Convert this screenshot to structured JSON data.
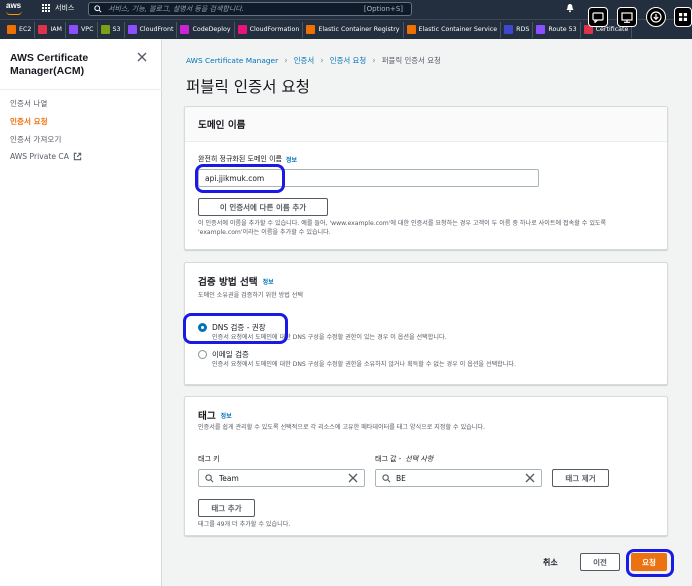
{
  "topnav": {
    "logo": "aws",
    "services_label": "서비스",
    "search_placeholder": "서비스, 기능, 블로그, 설명서 등을 검색합니다.",
    "search_shortcut": "[Option+S]"
  },
  "bookmarks": [
    {
      "label": "EC2",
      "color": "#ed7100"
    },
    {
      "label": "IAM",
      "color": "#dd344c"
    },
    {
      "label": "VPC",
      "color": "#8c4fff"
    },
    {
      "label": "S3",
      "color": "#7aa116"
    },
    {
      "label": "CloudFront",
      "color": "#8c4fff"
    },
    {
      "label": "CodeDeploy",
      "color": "#c925d1"
    },
    {
      "label": "CloudFormation",
      "color": "#e7157b"
    },
    {
      "label": "Elastic Container Registry",
      "color": "#ed7100"
    },
    {
      "label": "Elastic Container Service",
      "color": "#ed7100"
    },
    {
      "label": "RDS",
      "color": "#3f48cc"
    },
    {
      "label": "Route 53",
      "color": "#8c4fff"
    },
    {
      "label": "Certificate",
      "color": "#dd344c"
    }
  ],
  "sidebar": {
    "title_line1": "AWS Certificate",
    "title_line2": "Manager(ACM)",
    "items": [
      {
        "label": "인증서 나열"
      },
      {
        "label": "인증서 요청"
      },
      {
        "label": "인증서 가져오기"
      },
      {
        "label": "AWS Private CA"
      }
    ]
  },
  "breadcrumb": {
    "root": "AWS Certificate Manager",
    "level1": "인증서",
    "level2": "인증서 요청",
    "current": "퍼블릭 인증서 요청"
  },
  "page_title": "퍼블릭 인증서 요청",
  "domain_panel": {
    "title": "도메인 이름",
    "field_label": "완전히 정규화된 도메인 이름",
    "info": "정보",
    "field_value": "api.jjikmuk.com",
    "add_button": "이 인증서에 다른 이름 추가",
    "help_line1": "이 인증서에 이름을 추가할 수 있습니다. 예를 들어, 'www.example.com'에 대한 인증서를 요청하는 경우 고객이 두 이름 중 하나로 사이트에 접속할 수 있도록",
    "help_line2": "'example.com'이라는 이름을 추가할 수 있습니다."
  },
  "validation_panel": {
    "title": "검증 방법 선택",
    "info": "정보",
    "subtitle": "도메인 소유권을 검증하기 위한 방법 선택",
    "options": [
      {
        "label": "DNS 검증 - 권장",
        "desc": "인증서 요청에서 도메인에 대한 DNS 구성을 수정할 권한이 있는 경우 이 옵션을 선택합니다.",
        "selected": true
      },
      {
        "label": "이메일 검증",
        "desc": "인증서 요청에서 도메인에 대한 DNS 구성을 수정할 권한을 소유하지 않거나 획득할 수 없는 경우 이 옵션을 선택합니다.",
        "selected": false
      }
    ]
  },
  "tags_panel": {
    "title": "태그",
    "info": "정보",
    "subtitle": "인증서를 쉽게 관리할 수 있도록 선택적으로 각 리소스에 고유한 메타데이터를 태그 양식으로 지정할 수 있습니다.",
    "key_label": "태그 키",
    "value_label": "태그 값 -",
    "value_label_optional": "선택 사항",
    "key_value": "Team",
    "value_value": "BE",
    "remove_button": "태그 제거",
    "add_button": "태그 추가",
    "limit_text": "태그를 49개 더 추가할 수 있습니다."
  },
  "footer": {
    "cancel": "취소",
    "previous": "이전",
    "submit": "요청"
  },
  "colors": {
    "accent": "#ec7211",
    "link": "#0073bb",
    "highlight": "#1a1ae6",
    "nav_bg": "#232f3e"
  }
}
